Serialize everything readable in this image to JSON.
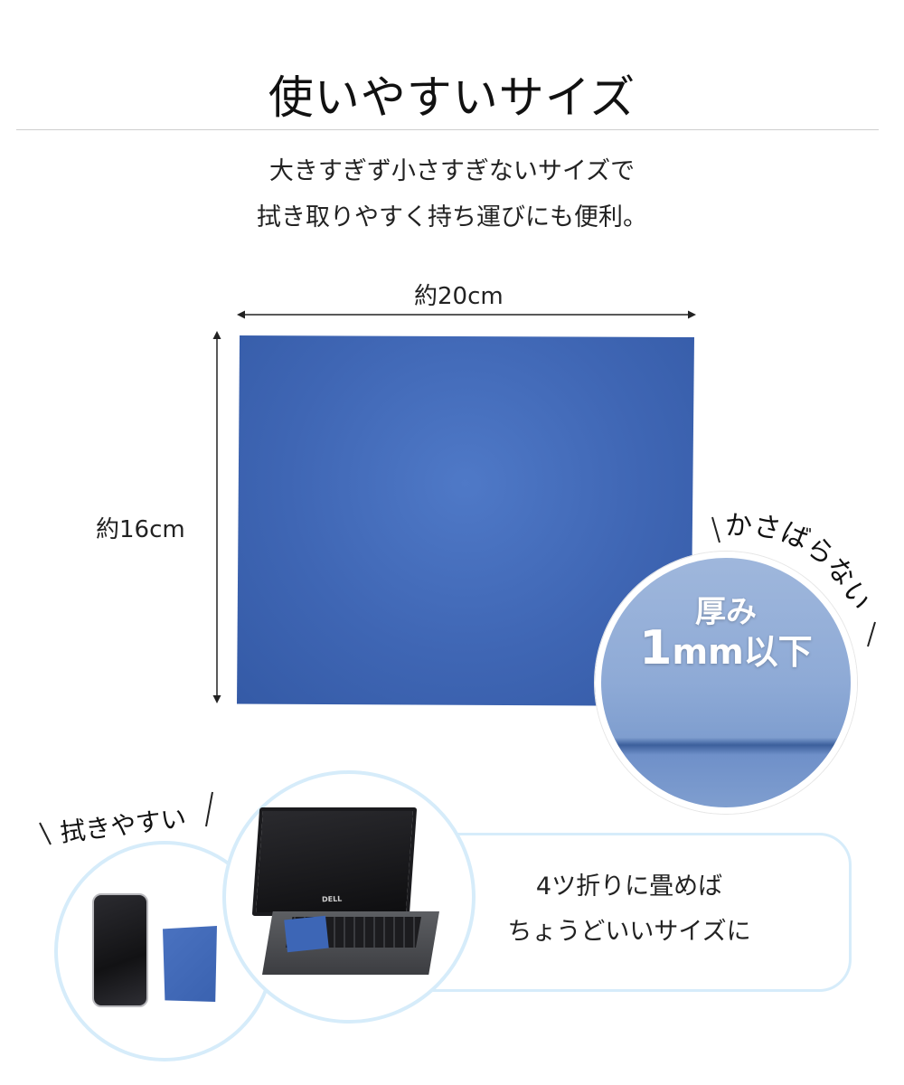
{
  "title": "使いやすいサイズ",
  "description": {
    "line1": "大きすぎず小さすぎないサイズで",
    "line2": "拭き取りやすく持ち運びにも便利。"
  },
  "dimensions": {
    "width_label": "約20cm",
    "height_label": "約16cm"
  },
  "callouts": {
    "compact": "かさばらない",
    "thickness_line1": "厚み",
    "thickness_number": "1",
    "thickness_unit": "mm以下",
    "easy_wipe": "拭きやすい"
  },
  "bubble": {
    "line1": "4ツ折りに畳めば",
    "line2": "ちょうどいいサイズに"
  },
  "laptop_logo": "DELL",
  "colors": {
    "cloth_blue": "#3f66b4",
    "accent_light_blue": "#d6ecfa"
  }
}
